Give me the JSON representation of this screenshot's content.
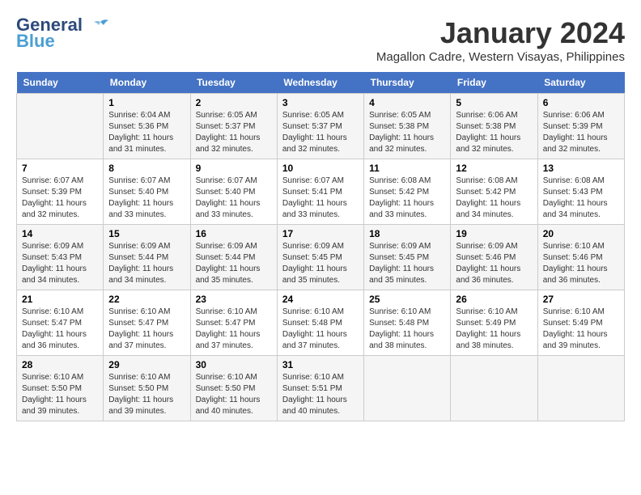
{
  "logo": {
    "line1": "General",
    "line2": "Blue"
  },
  "title": {
    "month_year": "January 2024",
    "location": "Magallon Cadre, Western Visayas, Philippines"
  },
  "header": {
    "days": [
      "Sunday",
      "Monday",
      "Tuesday",
      "Wednesday",
      "Thursday",
      "Friday",
      "Saturday"
    ]
  },
  "weeks": [
    [
      {
        "day": "",
        "content": ""
      },
      {
        "day": "1",
        "content": "Sunrise: 6:04 AM\nSunset: 5:36 PM\nDaylight: 11 hours\nand 31 minutes."
      },
      {
        "day": "2",
        "content": "Sunrise: 6:05 AM\nSunset: 5:37 PM\nDaylight: 11 hours\nand 32 minutes."
      },
      {
        "day": "3",
        "content": "Sunrise: 6:05 AM\nSunset: 5:37 PM\nDaylight: 11 hours\nand 32 minutes."
      },
      {
        "day": "4",
        "content": "Sunrise: 6:05 AM\nSunset: 5:38 PM\nDaylight: 11 hours\nand 32 minutes."
      },
      {
        "day": "5",
        "content": "Sunrise: 6:06 AM\nSunset: 5:38 PM\nDaylight: 11 hours\nand 32 minutes."
      },
      {
        "day": "6",
        "content": "Sunrise: 6:06 AM\nSunset: 5:39 PM\nDaylight: 11 hours\nand 32 minutes."
      }
    ],
    [
      {
        "day": "7",
        "content": "Sunrise: 6:07 AM\nSunset: 5:39 PM\nDaylight: 11 hours\nand 32 minutes."
      },
      {
        "day": "8",
        "content": "Sunrise: 6:07 AM\nSunset: 5:40 PM\nDaylight: 11 hours\nand 33 minutes."
      },
      {
        "day": "9",
        "content": "Sunrise: 6:07 AM\nSunset: 5:40 PM\nDaylight: 11 hours\nand 33 minutes."
      },
      {
        "day": "10",
        "content": "Sunrise: 6:07 AM\nSunset: 5:41 PM\nDaylight: 11 hours\nand 33 minutes."
      },
      {
        "day": "11",
        "content": "Sunrise: 6:08 AM\nSunset: 5:42 PM\nDaylight: 11 hours\nand 33 minutes."
      },
      {
        "day": "12",
        "content": "Sunrise: 6:08 AM\nSunset: 5:42 PM\nDaylight: 11 hours\nand 34 minutes."
      },
      {
        "day": "13",
        "content": "Sunrise: 6:08 AM\nSunset: 5:43 PM\nDaylight: 11 hours\nand 34 minutes."
      }
    ],
    [
      {
        "day": "14",
        "content": "Sunrise: 6:09 AM\nSunset: 5:43 PM\nDaylight: 11 hours\nand 34 minutes."
      },
      {
        "day": "15",
        "content": "Sunrise: 6:09 AM\nSunset: 5:44 PM\nDaylight: 11 hours\nand 34 minutes."
      },
      {
        "day": "16",
        "content": "Sunrise: 6:09 AM\nSunset: 5:44 PM\nDaylight: 11 hours\nand 35 minutes."
      },
      {
        "day": "17",
        "content": "Sunrise: 6:09 AM\nSunset: 5:45 PM\nDaylight: 11 hours\nand 35 minutes."
      },
      {
        "day": "18",
        "content": "Sunrise: 6:09 AM\nSunset: 5:45 PM\nDaylight: 11 hours\nand 35 minutes."
      },
      {
        "day": "19",
        "content": "Sunrise: 6:09 AM\nSunset: 5:46 PM\nDaylight: 11 hours\nand 36 minutes."
      },
      {
        "day": "20",
        "content": "Sunrise: 6:10 AM\nSunset: 5:46 PM\nDaylight: 11 hours\nand 36 minutes."
      }
    ],
    [
      {
        "day": "21",
        "content": "Sunrise: 6:10 AM\nSunset: 5:47 PM\nDaylight: 11 hours\nand 36 minutes."
      },
      {
        "day": "22",
        "content": "Sunrise: 6:10 AM\nSunset: 5:47 PM\nDaylight: 11 hours\nand 37 minutes."
      },
      {
        "day": "23",
        "content": "Sunrise: 6:10 AM\nSunset: 5:47 PM\nDaylight: 11 hours\nand 37 minutes."
      },
      {
        "day": "24",
        "content": "Sunrise: 6:10 AM\nSunset: 5:48 PM\nDaylight: 11 hours\nand 37 minutes."
      },
      {
        "day": "25",
        "content": "Sunrise: 6:10 AM\nSunset: 5:48 PM\nDaylight: 11 hours\nand 38 minutes."
      },
      {
        "day": "26",
        "content": "Sunrise: 6:10 AM\nSunset: 5:49 PM\nDaylight: 11 hours\nand 38 minutes."
      },
      {
        "day": "27",
        "content": "Sunrise: 6:10 AM\nSunset: 5:49 PM\nDaylight: 11 hours\nand 39 minutes."
      }
    ],
    [
      {
        "day": "28",
        "content": "Sunrise: 6:10 AM\nSunset: 5:50 PM\nDaylight: 11 hours\nand 39 minutes."
      },
      {
        "day": "29",
        "content": "Sunrise: 6:10 AM\nSunset: 5:50 PM\nDaylight: 11 hours\nand 39 minutes."
      },
      {
        "day": "30",
        "content": "Sunrise: 6:10 AM\nSunset: 5:50 PM\nDaylight: 11 hours\nand 40 minutes."
      },
      {
        "day": "31",
        "content": "Sunrise: 6:10 AM\nSunset: 5:51 PM\nDaylight: 11 hours\nand 40 minutes."
      },
      {
        "day": "",
        "content": ""
      },
      {
        "day": "",
        "content": ""
      },
      {
        "day": "",
        "content": ""
      }
    ]
  ]
}
